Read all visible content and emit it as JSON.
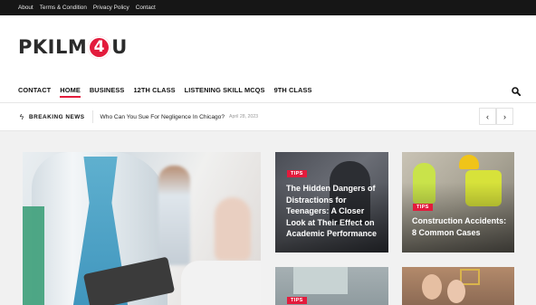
{
  "topbar": {
    "links": [
      "About",
      "Terms & Condition",
      "Privacy Policy",
      "Contact"
    ]
  },
  "logo": {
    "left": "PKILM",
    "circle": "4",
    "right": "U"
  },
  "nav": {
    "items": [
      "CONTACT",
      "HOME",
      "BUSINESS",
      "12TH CLASS",
      "LISTENING SKILL MCQS",
      "9TH CLASS"
    ],
    "active": "HOME"
  },
  "breaking": {
    "label": "BREAKING NEWS",
    "title": "Who Can You Sue For Negligence In Chicago?",
    "date": "April 28, 2023",
    "prev_icon": "chevron-left-icon",
    "next_icon": "chevron-right-icon"
  },
  "cards": [
    {
      "tag": "TIPS",
      "title": "The Hidden Dangers of Distractions for Teenagers: A Closer Look at Their Effect on Academic Performance"
    },
    {
      "tag": "TIPS",
      "title": "Construction Accidents: 8 Common Cases"
    },
    {
      "tag": "TIPS",
      "title": ""
    }
  ],
  "colors": {
    "accent": "#e31b3c",
    "topbar": "#161616"
  }
}
